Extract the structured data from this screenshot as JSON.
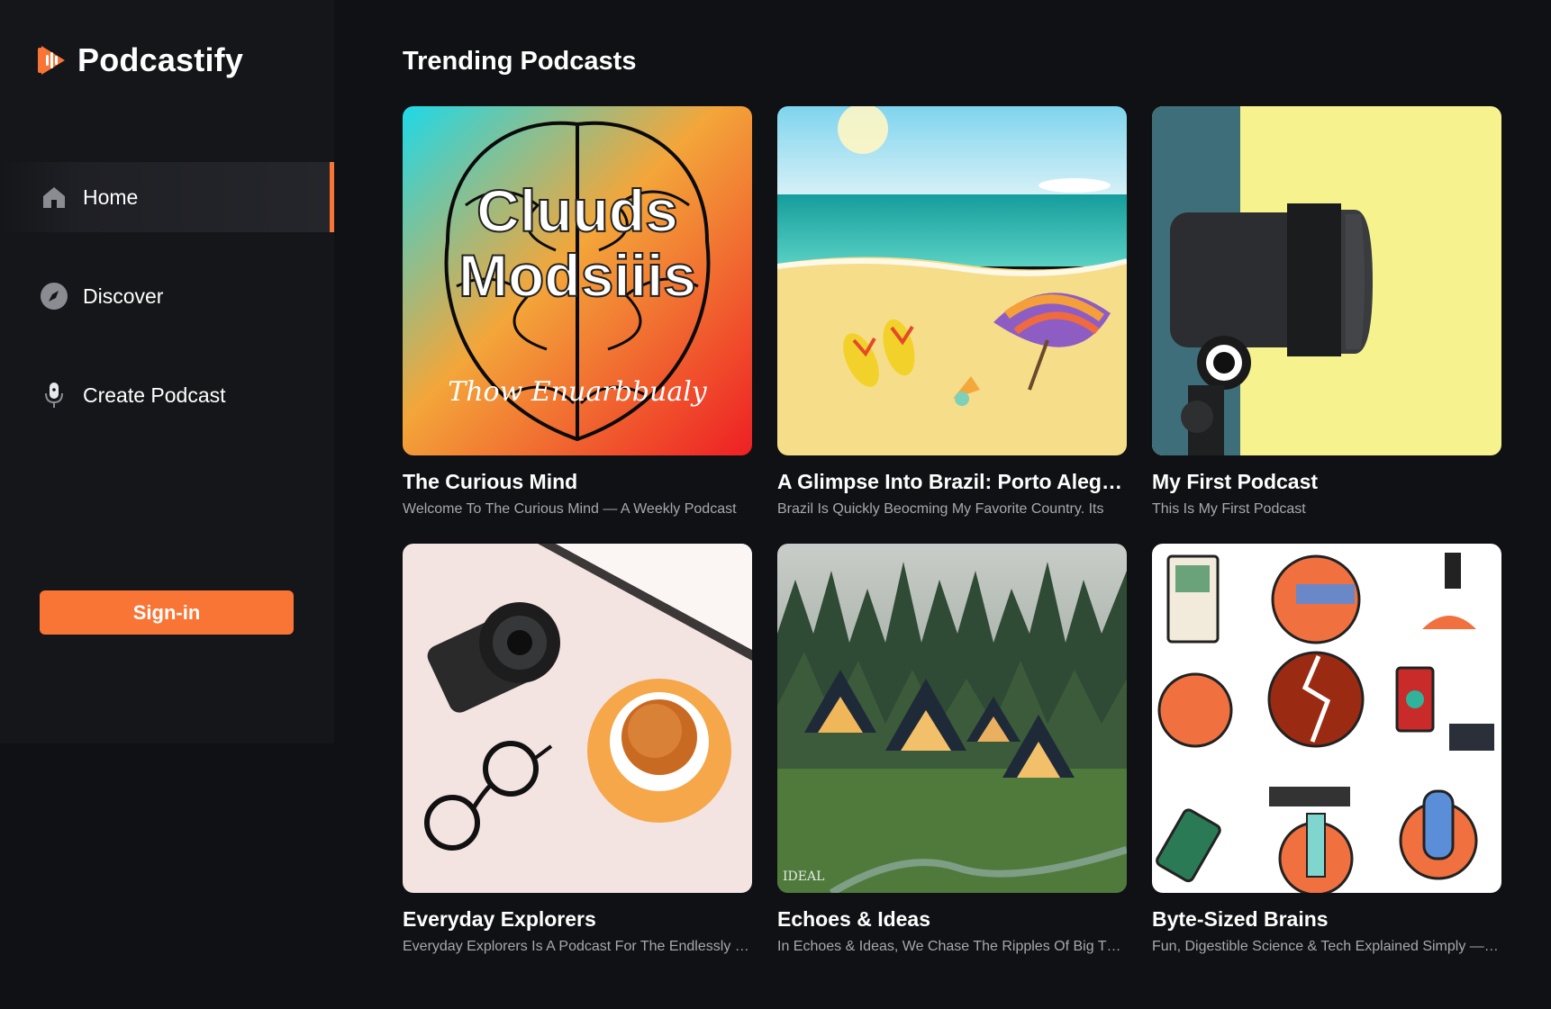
{
  "app": {
    "brand": "Podcastify",
    "accent_color": "#f97535"
  },
  "sidebar": {
    "items": [
      {
        "label": "Home",
        "icon": "home-icon",
        "active": true
      },
      {
        "label": "Discover",
        "icon": "compass-icon",
        "active": false
      },
      {
        "label": "Create Podcast",
        "icon": "microphone-icon",
        "active": false
      }
    ],
    "signin_label": "Sign-in"
  },
  "main": {
    "section_title": "Trending Podcasts",
    "podcasts": [
      {
        "title": "The Curious Mind",
        "description": "Welcome To The Curious Mind — A Weekly Podcast",
        "cover": "brain-illustration",
        "cover_text_1": "Cluuds",
        "cover_text_2": "Modsiiis",
        "cover_text_3": "Thow Enuarbbualy"
      },
      {
        "title": "A Glimpse Into Brazil: Porto Alegre Edition",
        "description": "Brazil Is Quickly Beocming My Favorite Country. Its",
        "cover": "beach-illustration"
      },
      {
        "title": "My First Podcast",
        "description": "This Is My First Podcast",
        "cover": "microphone-photo"
      },
      {
        "title": "Everyday Explorers",
        "description": "Everyday Explorers Is A Podcast For The Endlessly Curious",
        "cover": "camera-tea-glasses-photo"
      },
      {
        "title": "Echoes & Ideas",
        "description": "In Echoes & Ideas, We Chase The Ripples Of Big Thoughts",
        "cover": "forest-cabins-photo",
        "cover_text_1": "IDEAL"
      },
      {
        "title": "Byte-Sized Brains",
        "description": "Fun, Digestible Science & Tech Explained Simply — Every Week",
        "cover": "science-tools-illustration"
      }
    ]
  }
}
